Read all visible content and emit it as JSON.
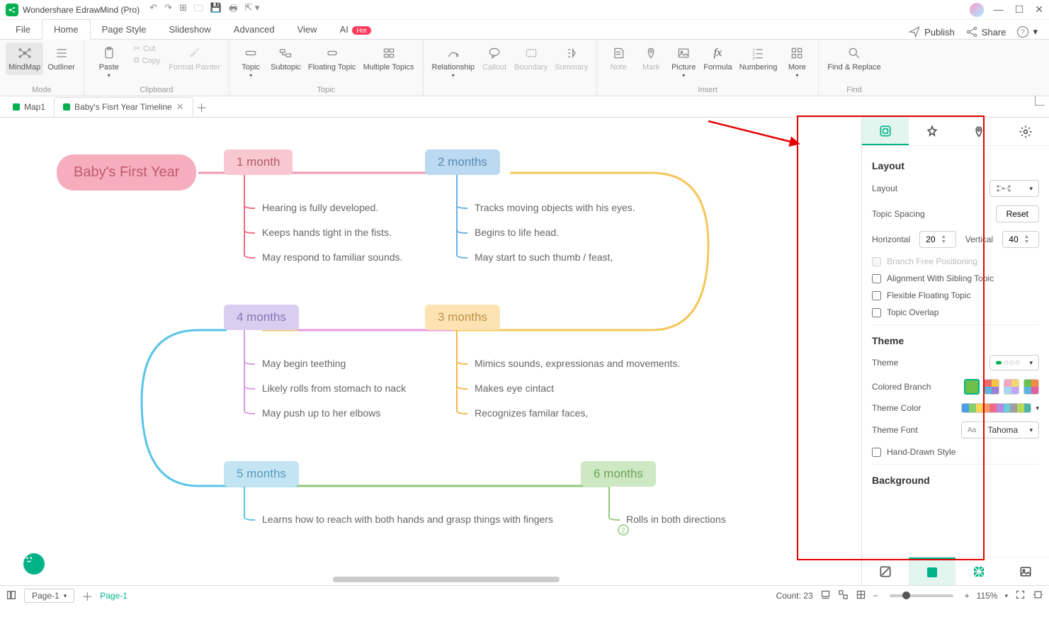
{
  "title": "Wondershare EdrawMind (Pro)",
  "menu": {
    "items": [
      "File",
      "Home",
      "Page Style",
      "Slideshow",
      "Advanced",
      "View",
      "AI"
    ],
    "active": 1,
    "ai_badge": "Hot",
    "publish": "Publish",
    "share": "Share"
  },
  "ribbon": {
    "mode": {
      "mindmap": "MindMap",
      "outliner": "Outliner",
      "label": "Mode"
    },
    "clipboard": {
      "paste": "Paste",
      "cut": "Cut",
      "copy": "Copy",
      "format": "Format Painter",
      "label": "Clipboard"
    },
    "topic": {
      "topic": "Topic",
      "subtopic": "Subtopic",
      "floating": "Floating Topic",
      "multiple": "Multiple Topics",
      "label": "Topic"
    },
    "relationship": "Relationship",
    "callout": "Callout",
    "boundary": "Boundary",
    "summary": "Summary",
    "insert": {
      "note": "Note",
      "mark": "Mark",
      "picture": "Picture",
      "formula": "Formula",
      "numbering": "Numbering",
      "more": "More",
      "label": "Insert"
    },
    "find": {
      "find": "Find & Replace",
      "label": "Find"
    }
  },
  "doctabs": {
    "t1": "Map1",
    "t2": "Baby's Fisrt Year Timeline"
  },
  "mindmap": {
    "root": "Baby's First Year",
    "m1": {
      "title": "1 month",
      "items": [
        "Hearing is fully developed.",
        "Keeps hands tight in the fists.",
        "May respond to familiar sounds."
      ]
    },
    "m2": {
      "title": "2 months",
      "items": [
        "Tracks moving objects with his eyes.",
        "Begins to life head.",
        "May start to such thumb / feast,"
      ]
    },
    "m3": {
      "title": "3 months",
      "items": [
        "Mimics sounds, expressionas and movements.",
        "Makes eye cintact",
        "Recognizes familar faces,"
      ]
    },
    "m4": {
      "title": "4 months",
      "items": [
        "May begin teething",
        "Likely rolls from stomach to nack",
        "May push up to her elbows"
      ]
    },
    "m5": {
      "title": "5 months",
      "items": [
        "Learns how to reach with both hands and grasp things with fingers"
      ]
    },
    "m6": {
      "title": "6 months",
      "items": [
        "Rolls in both directions"
      ]
    }
  },
  "rpanel": {
    "layout": {
      "h": "Layout",
      "layout": "Layout",
      "spacing": "Topic Spacing",
      "reset": "Reset",
      "horizontal": "Horizontal",
      "hval": "20",
      "vertical": "Vertical",
      "vval": "40",
      "branch": "Branch Free Positioning",
      "align": "Alignment With Sibling Topic",
      "flex": "Flexible Floating Topic",
      "overlap": "Topic Overlap"
    },
    "theme": {
      "h": "Theme",
      "theme": "Theme",
      "colored": "Colored Branch",
      "color": "Theme Color",
      "font": "Theme Font",
      "fontval": "Tahoma",
      "hand": "Hand-Drawn Style"
    },
    "bg": "Background"
  },
  "theme_colors": [
    "#4b9fe8",
    "#85d06a",
    "#f9d659",
    "#f7a05e",
    "#f16a8a",
    "#b08de0",
    "#6dc9dc",
    "#9e9e9e",
    "#b6d957",
    "#4db6ac"
  ],
  "status": {
    "page_sel": "Page-1",
    "page_tab": "Page-1",
    "count": "Count: 23",
    "zoom": "115%"
  }
}
